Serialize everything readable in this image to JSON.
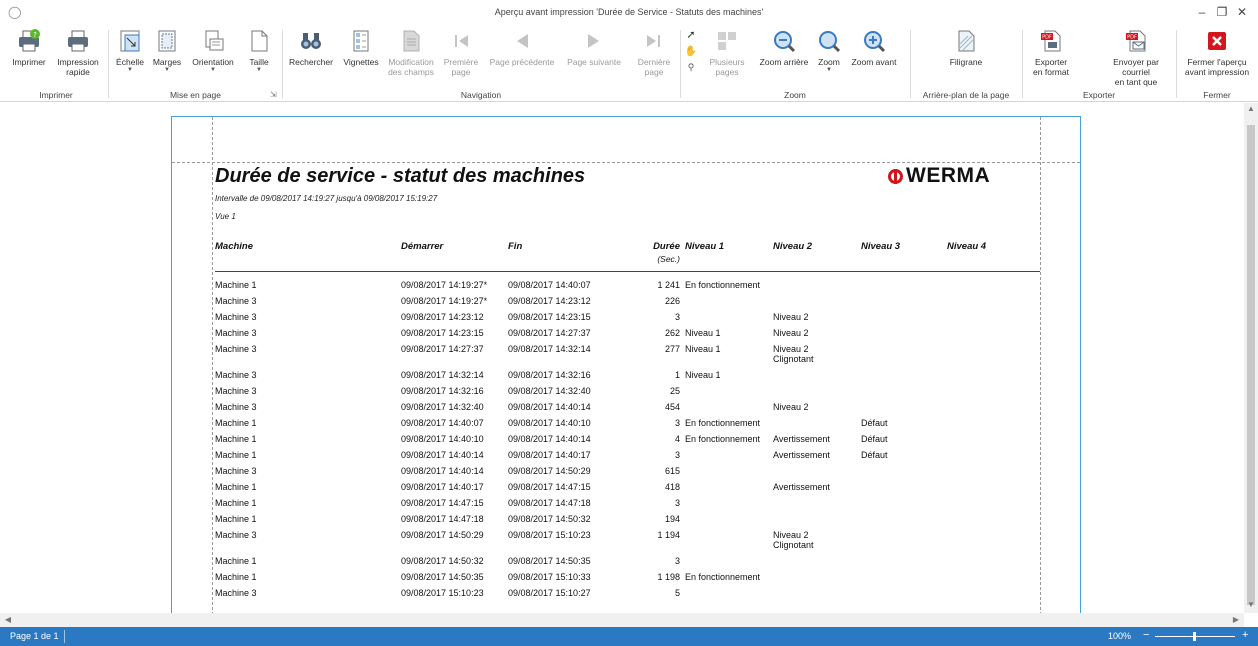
{
  "window": {
    "title": "Aperçu avant impression 'Durée de Service - Statuts des machines'",
    "minimize": "–",
    "restore": "❐",
    "close": "✕"
  },
  "ribbon": {
    "print": "Imprimer",
    "quick_print_1": "Impression",
    "quick_print_2": "rapide",
    "scale": "Échelle",
    "margins": "Marges",
    "orientation": "Orientation",
    "size": "Taille",
    "find": "Rechercher",
    "thumbnails": "Vignettes",
    "edit_fields_1": "Modification",
    "edit_fields_2": "des champs",
    "first_page_1": "Première",
    "first_page_2": "page",
    "prev_page": "Page précédente",
    "next_page": "Page suivante",
    "last_page_1": "Dernière",
    "last_page_2": "page",
    "multiple_pages_1": "Plusieurs",
    "multiple_pages_2": "pages",
    "zoom_out": "Zoom arrière",
    "zoom": "Zoom",
    "zoom_in": "Zoom avant",
    "watermark": "Filigrane",
    "export_1": "Exporter",
    "export_2": "en format",
    "send_1": "Envoyer par courriel",
    "send_2": "en tant que",
    "close_preview_1": "Fermer l'aperçu",
    "close_preview_2": "avant impression",
    "groups": {
      "print": "Imprimer",
      "page_setup": "Mise en page",
      "navigation": "Navigation",
      "zoom": "Zoom",
      "background": "Arrière-plan de la page",
      "export": "Exporter",
      "close": "Fermer"
    }
  },
  "report": {
    "title": "Durée de service - statut des machines",
    "interval": "Intervalle de 09/08/2017 14:19:27 jusqu'à 09/08/2017 15:19:27",
    "view": "Vue 1",
    "logo": "WERMA",
    "headers": {
      "machine": "Machine",
      "start": "Démarrer",
      "end": "Fin",
      "duration": "Durée",
      "duration_unit": "(Sec.)",
      "level1": "Niveau 1",
      "level2": "Niveau 2",
      "level3": "Niveau 3",
      "level4": "Niveau 4"
    },
    "rows": [
      {
        "machine": "Machine 1",
        "start": "09/08/2017 14:19:27*",
        "end": "09/08/2017 14:40:07",
        "duration": "1 241",
        "n1": "En fonctionnement",
        "n2": "",
        "n2b": "",
        "n3": "",
        "n4": ""
      },
      {
        "machine": "Machine 3",
        "start": "09/08/2017 14:19:27*",
        "end": "09/08/2017 14:23:12",
        "duration": "226",
        "n1": "",
        "n2": "",
        "n2b": "",
        "n3": "",
        "n4": ""
      },
      {
        "machine": "Machine 3",
        "start": "09/08/2017 14:23:12",
        "end": "09/08/2017 14:23:15",
        "duration": "3",
        "n1": "",
        "n2": "Niveau 2",
        "n2b": "",
        "n3": "",
        "n4": ""
      },
      {
        "machine": "Machine 3",
        "start": "09/08/2017 14:23:15",
        "end": "09/08/2017 14:27:37",
        "duration": "262",
        "n1": "Niveau 1",
        "n2": "Niveau 2",
        "n2b": "",
        "n3": "",
        "n4": ""
      },
      {
        "machine": "Machine 3",
        "start": "09/08/2017 14:27:37",
        "end": "09/08/2017 14:32:14",
        "duration": "277",
        "n1": "Niveau 1",
        "n2": "Niveau 2",
        "n2b": "Clignotant",
        "n3": "",
        "n4": ""
      },
      {
        "machine": "Machine 3",
        "start": "09/08/2017 14:32:14",
        "end": "09/08/2017 14:32:16",
        "duration": "1",
        "n1": "Niveau 1",
        "n2": "",
        "n2b": "",
        "n3": "",
        "n4": ""
      },
      {
        "machine": "Machine 3",
        "start": "09/08/2017 14:32:16",
        "end": "09/08/2017 14:32:40",
        "duration": "25",
        "n1": "",
        "n2": "",
        "n2b": "",
        "n3": "",
        "n4": ""
      },
      {
        "machine": "Machine 3",
        "start": "09/08/2017 14:32:40",
        "end": "09/08/2017 14:40:14",
        "duration": "454",
        "n1": "",
        "n2": "Niveau 2",
        "n2b": "",
        "n3": "",
        "n4": ""
      },
      {
        "machine": "Machine 1",
        "start": "09/08/2017 14:40:07",
        "end": "09/08/2017 14:40:10",
        "duration": "3",
        "n1": "En fonctionnement",
        "n2": "",
        "n2b": "",
        "n3": "Défaut",
        "n4": ""
      },
      {
        "machine": "Machine 1",
        "start": "09/08/2017 14:40:10",
        "end": "09/08/2017 14:40:14",
        "duration": "4",
        "n1": "En fonctionnement",
        "n2": "Avertissement",
        "n2b": "",
        "n3": "Défaut",
        "n4": ""
      },
      {
        "machine": "Machine 1",
        "start": "09/08/2017 14:40:14",
        "end": "09/08/2017 14:40:17",
        "duration": "3",
        "n1": "",
        "n2": "Avertissement",
        "n2b": "",
        "n3": "Défaut",
        "n4": ""
      },
      {
        "machine": "Machine 3",
        "start": "09/08/2017 14:40:14",
        "end": "09/08/2017 14:50:29",
        "duration": "615",
        "n1": "",
        "n2": "",
        "n2b": "",
        "n3": "",
        "n4": ""
      },
      {
        "machine": "Machine 1",
        "start": "09/08/2017 14:40:17",
        "end": "09/08/2017 14:47:15",
        "duration": "418",
        "n1": "",
        "n2": "Avertissement",
        "n2b": "",
        "n3": "",
        "n4": ""
      },
      {
        "machine": "Machine 1",
        "start": "09/08/2017 14:47:15",
        "end": "09/08/2017 14:47:18",
        "duration": "3",
        "n1": "",
        "n2": "",
        "n2b": "",
        "n3": "",
        "n4": ""
      },
      {
        "machine": "Machine 1",
        "start": "09/08/2017 14:47:18",
        "end": "09/08/2017 14:50:32",
        "duration": "194",
        "n1": "",
        "n2": "",
        "n2b": "",
        "n3": "",
        "n4": ""
      },
      {
        "machine": "Machine 3",
        "start": "09/08/2017 14:50:29",
        "end": "09/08/2017 15:10:23",
        "duration": "1 194",
        "n1": "",
        "n2": "Niveau 2",
        "n2b": "Clignotant",
        "n3": "",
        "n4": ""
      },
      {
        "machine": "Machine 1",
        "start": "09/08/2017 14:50:32",
        "end": "09/08/2017 14:50:35",
        "duration": "3",
        "n1": "",
        "n2": "",
        "n2b": "",
        "n3": "",
        "n4": ""
      },
      {
        "machine": "Machine 1",
        "start": "09/08/2017 14:50:35",
        "end": "09/08/2017 15:10:33",
        "duration": "1 198",
        "n1": "En fonctionnement",
        "n2": "",
        "n2b": "",
        "n3": "",
        "n4": ""
      },
      {
        "machine": "Machine 3",
        "start": "09/08/2017 15:10:23",
        "end": "09/08/2017 15:10:27",
        "duration": "5",
        "n1": "",
        "n2": "",
        "n2b": "",
        "n3": "",
        "n4": ""
      }
    ]
  },
  "status": {
    "page": "Page 1 de 1",
    "zoom": "100%",
    "zoom_minus": "−",
    "zoom_plus": "+"
  },
  "icons": {
    "app": "printer-preview-icon",
    "accent": "#2b79c2",
    "logo_red": "#d2161e"
  }
}
